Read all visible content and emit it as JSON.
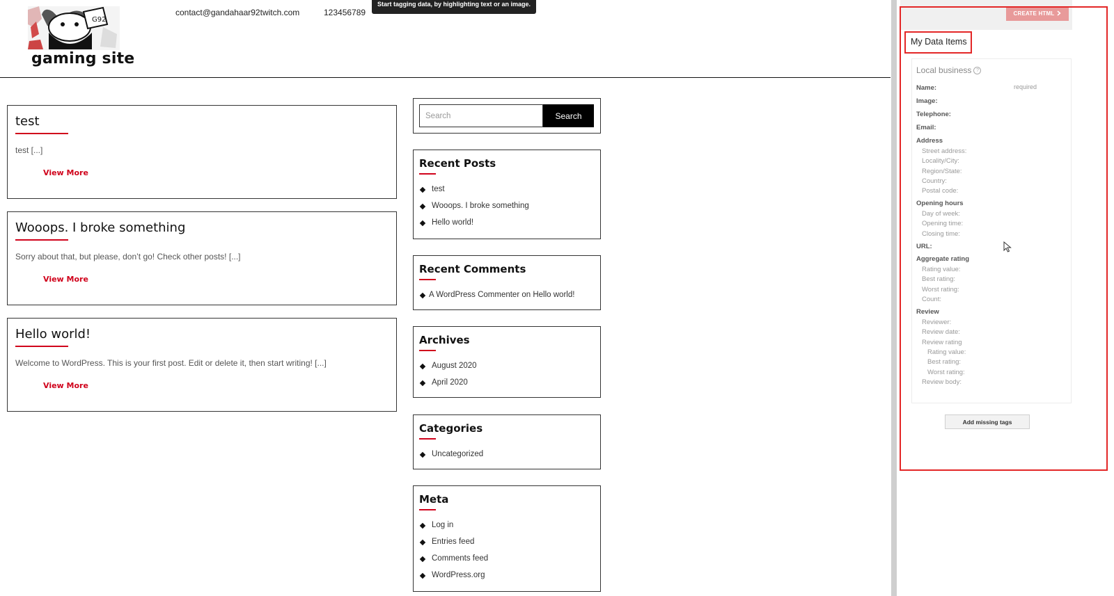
{
  "header": {
    "site_title": "gaming site",
    "email": "contact@gandahaar92twitch.com",
    "phone": "123456789",
    "tooltip": "Start tagging data, by highlighting text or an image."
  },
  "posts": [
    {
      "title": "test",
      "excerpt": "test [...]",
      "more": "View More"
    },
    {
      "title": "Wooops. I broke something",
      "excerpt": "Sorry about that, but please, don’t go! Check other posts! [...]",
      "more": "View More"
    },
    {
      "title": "Hello world!",
      "excerpt": "Welcome to WordPress. This is your first post. Edit or delete it, then start writing! [...]",
      "more": "View More"
    }
  ],
  "search": {
    "placeholder": "Search",
    "button": "Search"
  },
  "widgets": {
    "recent_posts": {
      "title": "Recent Posts",
      "items": [
        "test",
        "Wooops. I broke something",
        "Hello world!"
      ]
    },
    "recent_comments": {
      "title": "Recent Comments",
      "items": [
        "A WordPress Commenter on Hello world!"
      ]
    },
    "archives": {
      "title": "Archives",
      "items": [
        "August 2020",
        "April 2020"
      ]
    },
    "categories": {
      "title": "Categories",
      "items": [
        "Uncategorized"
      ]
    },
    "meta": {
      "title": "Meta",
      "items": [
        "Log in",
        "Entries feed",
        "Comments feed",
        "WordPress.org"
      ]
    }
  },
  "panel": {
    "create_button": "CREATE HTML",
    "my_data_items": "My Data Items",
    "schema_title": "Local business",
    "required": "required",
    "fields": [
      {
        "label": "Name:",
        "level": "main"
      },
      {
        "label": "Image:",
        "level": "main"
      },
      {
        "label": "Telephone:",
        "level": "main"
      },
      {
        "label": "Email:",
        "level": "main"
      },
      {
        "label": "Address",
        "level": "main"
      },
      {
        "label": "Street address:",
        "level": "sub"
      },
      {
        "label": "Locality/City:",
        "level": "sub"
      },
      {
        "label": "Region/State:",
        "level": "sub"
      },
      {
        "label": "Country:",
        "level": "sub"
      },
      {
        "label": "Postal code:",
        "level": "sub"
      },
      {
        "label": "Opening hours",
        "level": "main"
      },
      {
        "label": "Day of week:",
        "level": "sub"
      },
      {
        "label": "Opening time:",
        "level": "sub"
      },
      {
        "label": "Closing time:",
        "level": "sub"
      },
      {
        "label": "URL:",
        "level": "main"
      },
      {
        "label": "Aggregate rating",
        "level": "main"
      },
      {
        "label": "Rating value:",
        "level": "sub"
      },
      {
        "label": "Best rating:",
        "level": "sub"
      },
      {
        "label": "Worst rating:",
        "level": "sub"
      },
      {
        "label": "Count:",
        "level": "sub"
      },
      {
        "label": "Review",
        "level": "main"
      },
      {
        "label": "Reviewer:",
        "level": "sub"
      },
      {
        "label": "Review date:",
        "level": "sub"
      },
      {
        "label": "Review rating",
        "level": "sub"
      },
      {
        "label": "Rating value:",
        "level": "subsub"
      },
      {
        "label": "Best rating:",
        "level": "subsub"
      },
      {
        "label": "Worst rating:",
        "level": "subsub"
      },
      {
        "label": "Review body:",
        "level": "sub"
      }
    ],
    "add_missing": "Add missing tags"
  },
  "colors": {
    "accent": "#d0021b",
    "highlight": "#e32626",
    "create_button": "#e89a9a"
  }
}
